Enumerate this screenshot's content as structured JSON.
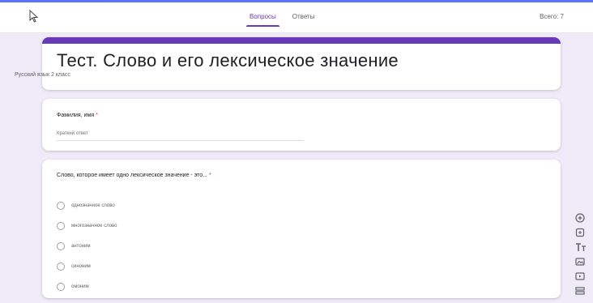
{
  "header": {
    "tabs": [
      {
        "label": "Вопросы",
        "active": true
      },
      {
        "label": "Ответы",
        "active": false
      }
    ],
    "total_label": "Всего: 7"
  },
  "form": {
    "title": "Тест. Слово и его лексическое значение",
    "description": "Русский язык 2 класс"
  },
  "questions": [
    {
      "title": "Фамилия, имя",
      "required_mark": "*",
      "placeholder": "Краткий ответ"
    },
    {
      "title": "Слово, которое имеет одно лексическое значение - это...",
      "required_mark": "*",
      "options": [
        "однозначное слово",
        "многозначное слово",
        "антоним",
        "синоним",
        "омоним"
      ]
    }
  ],
  "colors": {
    "accent": "#673ab7",
    "page_background": "#f0ebf8"
  },
  "icons": [
    "cursor-icon",
    "add-question-icon",
    "import-questions-icon",
    "add-title-icon",
    "add-image-icon",
    "add-video-icon",
    "add-section-icon"
  ]
}
